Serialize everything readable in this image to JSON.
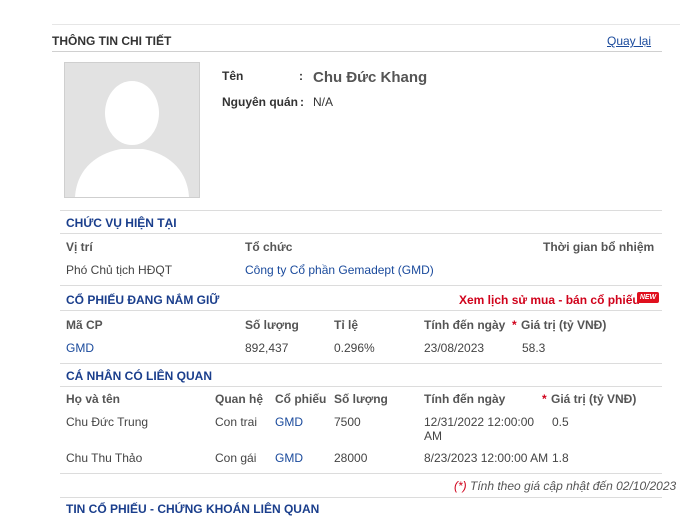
{
  "header": {
    "title": "THÔNG TIN CHI TIẾT",
    "back_link": "Quay lại"
  },
  "profile": {
    "name_label": "Tên",
    "name_colon": ":",
    "name_value": "Chu Đức Khang",
    "origin_label": "Nguyên quán",
    "origin_colon": ":",
    "origin_value": "N/A"
  },
  "position_section": {
    "title": "CHỨC VỤ HIỆN TẠI",
    "headers": {
      "role": "Vị trí",
      "org": "Tổ chức",
      "appointed": "Thời gian bổ nhiệm"
    },
    "rows": [
      {
        "role": "Phó Chủ tịch HĐQT",
        "org": "Công ty Cổ phần Gemadept (GMD)",
        "appointed": ""
      }
    ]
  },
  "holdings_section": {
    "title": "CỔ PHIẾU ĐANG NẮM GIỮ",
    "history_link": "Xem lịch sử mua - bán cổ phiếu",
    "new_badge": "NEW",
    "headers": {
      "code": "Mã CP",
      "quantity": "Số lượng",
      "ratio": "Tỉ lệ",
      "as_of": "Tính đến ngày",
      "value_star": "*",
      "value": "Giá trị (tỷ VNĐ)"
    },
    "rows": [
      {
        "code": "GMD",
        "quantity": "892,437",
        "ratio": "0.296%",
        "as_of": "23/08/2023",
        "value": "58.3"
      }
    ]
  },
  "related_section": {
    "title": "CÁ NHÂN CÓ LIÊN QUAN",
    "headers": {
      "name": "Họ và tên",
      "relation": "Quan hệ",
      "stock": "Cổ phiếu",
      "quantity": "Số lượng",
      "as_of": "Tính đến ngày",
      "value_star": "*",
      "value": "Giá trị (tỷ VNĐ)"
    },
    "rows": [
      {
        "name": "Chu Đức Trung",
        "relation": "Con trai",
        "stock": "GMD",
        "quantity": "7500",
        "as_of_line1": "12/31/2022 12:00:00",
        "as_of_line2": "AM",
        "value": "0.5"
      },
      {
        "name": "Chu Thu Thảo",
        "relation": "Con gái",
        "stock": "GMD",
        "quantity": "28000",
        "as_of_line1": "8/23/2023 12:00:00 AM",
        "as_of_line2": "",
        "value": "1.8"
      }
    ]
  },
  "footnote": {
    "mark": "(*)",
    "text": " Tính theo giá cập nhật đến 02/10/2023"
  },
  "next_section_title": "TIN CỔ PHIẾU - CHỨNG KHOÁN LIÊN QUAN"
}
